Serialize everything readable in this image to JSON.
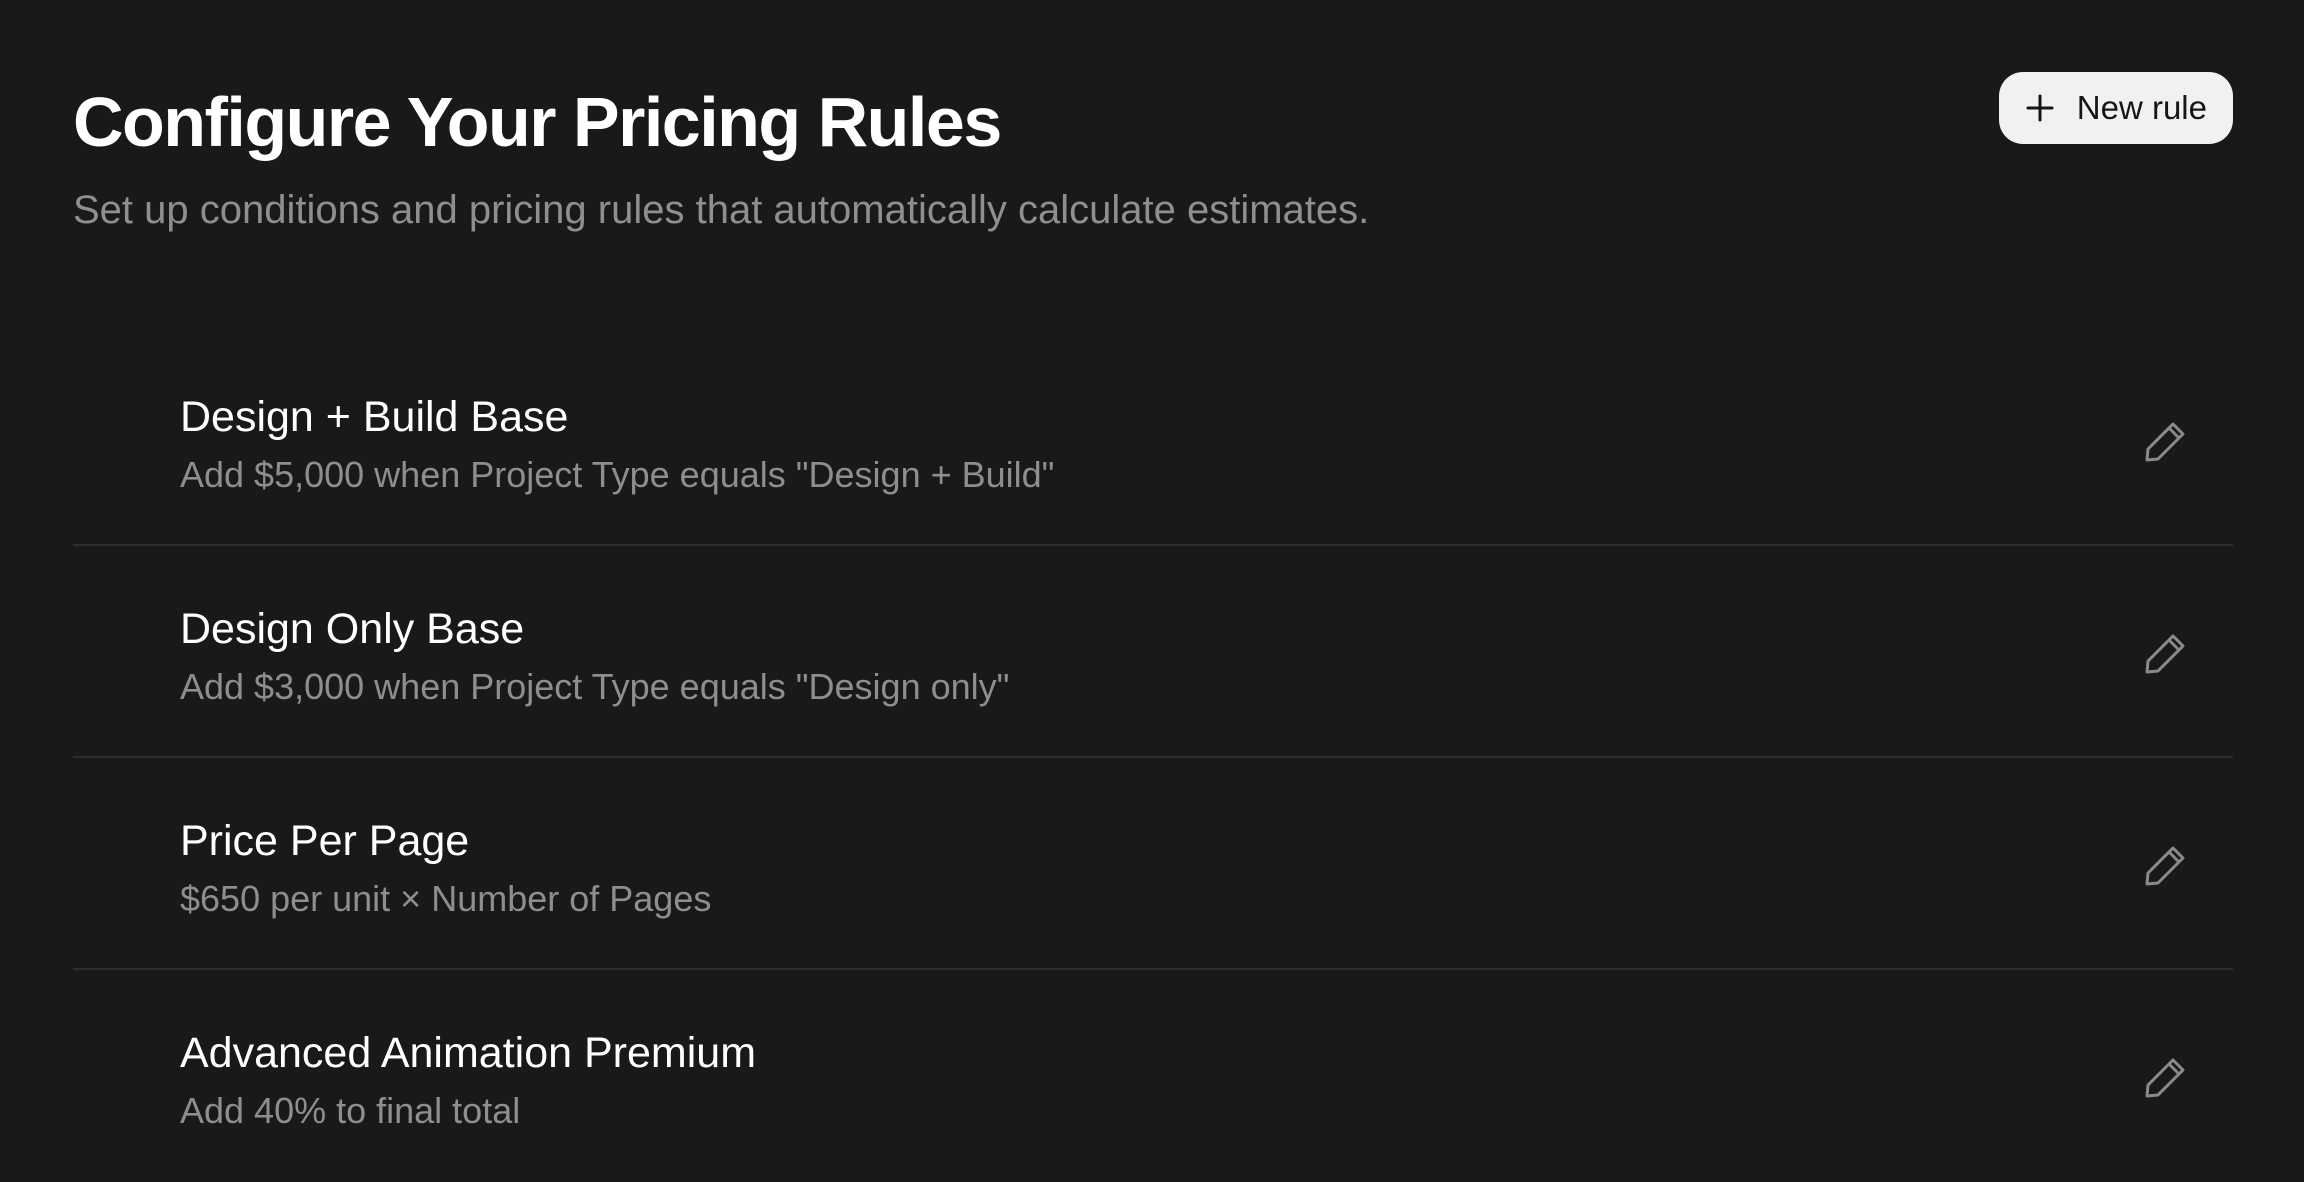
{
  "header": {
    "title": "Configure Your Pricing Rules",
    "subtitle": "Set up conditions and pricing rules that automatically calculate estimates.",
    "new_rule_label": "New rule",
    "new_rule_icon": "plus-icon"
  },
  "rules": [
    {
      "name": "Design + Build Base",
      "description": "Add $5,000 when Project Type equals \"Design + Build\"",
      "action_icon": "pencil-icon"
    },
    {
      "name": "Design Only Base",
      "description": "Add $3,000 when Project Type equals \"Design only\"",
      "action_icon": "pencil-icon"
    },
    {
      "name": "Price Per Page",
      "description": "$650 per unit × Number of Pages",
      "action_icon": "pencil-icon"
    },
    {
      "name": "Advanced Animation Premium",
      "description": "Add 40% to final total",
      "action_icon": "pencil-icon"
    }
  ],
  "colors": {
    "background": "#191919",
    "title": "#ffffff",
    "muted_text": "#8e8e8e",
    "divider": "#2c2c2c",
    "button_background": "#f1f1f1",
    "button_text": "#161616",
    "icon": "#8a8a8a"
  }
}
